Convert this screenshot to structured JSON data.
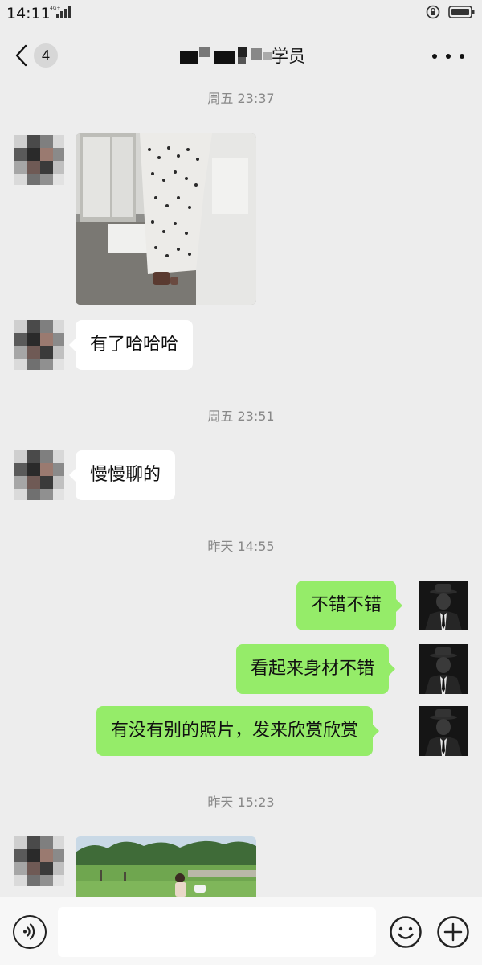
{
  "status_bar": {
    "time": "14:11",
    "network": "4G+"
  },
  "nav": {
    "back_count": "4",
    "title_suffix": "学员",
    "back_icon": "chevron-left-icon",
    "more_icon": "more-dots-icon"
  },
  "messages": [
    {
      "type": "timestamp",
      "text": "周五 23:37"
    },
    {
      "type": "image",
      "from": "other",
      "content": "photo of person in polka dot dress"
    },
    {
      "type": "text",
      "from": "other",
      "text": "有了哈哈哈"
    },
    {
      "type": "timestamp",
      "text": "周五 23:51"
    },
    {
      "type": "text",
      "from": "other",
      "text": "慢慢聊的"
    },
    {
      "type": "timestamp",
      "text": "昨天 14:55"
    },
    {
      "type": "text",
      "from": "me",
      "text": "不错不错"
    },
    {
      "type": "text",
      "from": "me",
      "text": "看起来身材不错"
    },
    {
      "type": "text",
      "from": "me",
      "text": "有没有别的照片，发来欣赏欣赏"
    },
    {
      "type": "timestamp",
      "text": "昨天 15:23"
    },
    {
      "type": "image",
      "from": "other",
      "content": "photo of person in park"
    }
  ],
  "input_bar": {
    "value": "",
    "voice_icon": "voice-icon",
    "emoji_icon": "emoji-icon",
    "plus_icon": "plus-icon"
  },
  "colors": {
    "background": "#ededed",
    "my_bubble": "#95ec69",
    "their_bubble": "#ffffff",
    "timestamp": "#888888"
  }
}
